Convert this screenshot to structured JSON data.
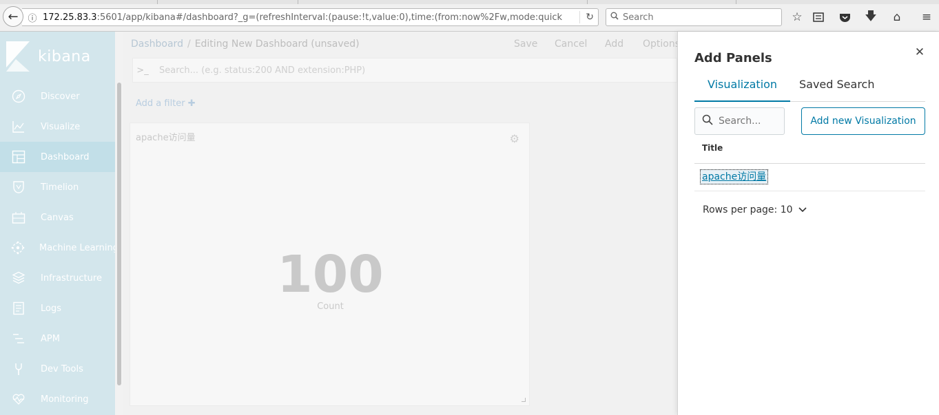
{
  "browser": {
    "url_host": "172.25.83.3",
    "url_rest": ":5601/app/kibana#/dashboard?_g=(refreshInterval:(pause:!t,value:0),time:(from:now%2Fw,mode:quick",
    "search_placeholder": "Search"
  },
  "sidebar": {
    "logo_text": "kibana",
    "items": [
      {
        "label": "Discover",
        "icon": "compass-icon"
      },
      {
        "label": "Visualize",
        "icon": "chart-icon"
      },
      {
        "label": "Dashboard",
        "icon": "dashboard-icon",
        "active": true
      },
      {
        "label": "Timelion",
        "icon": "shield-icon"
      },
      {
        "label": "Canvas",
        "icon": "canvas-icon"
      },
      {
        "label": "Machine Learning",
        "icon": "ml-icon"
      },
      {
        "label": "Infrastructure",
        "icon": "infrastructure-icon"
      },
      {
        "label": "Logs",
        "icon": "logs-icon"
      },
      {
        "label": "APM",
        "icon": "apm-icon"
      },
      {
        "label": "Dev Tools",
        "icon": "wrench-icon"
      },
      {
        "label": "Monitoring",
        "icon": "heartbeat-icon"
      }
    ]
  },
  "main": {
    "breadcrumb_root": "Dashboard",
    "breadcrumb_sep": "/",
    "breadcrumb_current": "Editing New Dashboard (unsaved)",
    "menu": {
      "save": "Save",
      "cancel": "Cancel",
      "add": "Add",
      "options": "Options"
    },
    "query_placeholder": "Search... (e.g. status:200 AND extension:PHP)",
    "add_filter": "Add a filter",
    "panel": {
      "title": "apache访问量",
      "value": "100",
      "label": "Count"
    }
  },
  "flyout": {
    "title": "Add Panels",
    "tabs": [
      "Visualization",
      "Saved Search"
    ],
    "search_placeholder": "Search...",
    "add_button": "Add new Visualization",
    "table_header": "Title",
    "rows": [
      "apache访问量"
    ],
    "rows_per_page": "Rows per page: 10"
  },
  "colors": {
    "accent": "#0079a5",
    "sidebar_bg": "#d3e6ec"
  }
}
